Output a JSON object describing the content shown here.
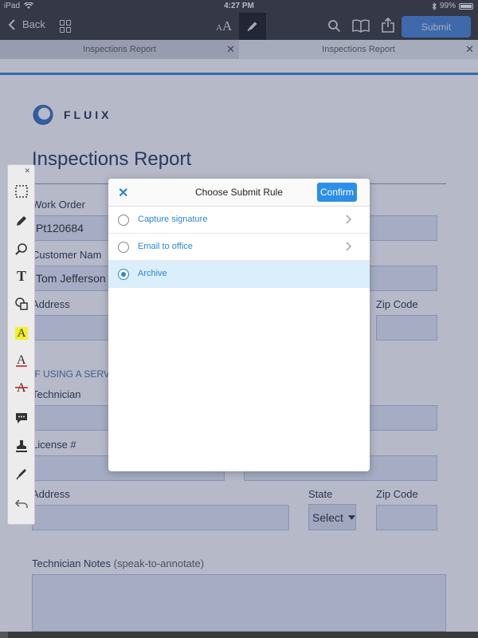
{
  "status_bar": {
    "device": "iPad",
    "time": "4:27 PM",
    "battery": "99%"
  },
  "toolbar": {
    "back_label": "Back",
    "submit_label": "Submit"
  },
  "tabs": [
    {
      "label": "Inspections Report"
    },
    {
      "label": "Inspections Report"
    }
  ],
  "document": {
    "logo_text": "FLUIX",
    "title": "Inspections Report",
    "work_order_label": "Work Order",
    "work_order_value": "Pt120684",
    "customer_name_label": "Customer Nam",
    "customer_name_value": "Tom Jefferson",
    "address_label": "Address",
    "zip_label": "Zip Code",
    "section_heading": "IF USING A SERV",
    "technician_label": "Technician",
    "license_label": "License #",
    "address2_label": "Address",
    "state_label": "State",
    "state_select_value": "Select",
    "zip2_label": "Zip Code",
    "notes_label": "Technician Notes",
    "notes_hint": "(speak-to-annotate)"
  },
  "modal": {
    "title": "Choose Submit Rule",
    "confirm_label": "Confirm",
    "options": [
      {
        "label": "Capture signature",
        "selected": false,
        "has_chevron": true
      },
      {
        "label": "Email to office",
        "selected": false,
        "has_chevron": true
      },
      {
        "label": "Archive",
        "selected": true,
        "has_chevron": false
      }
    ]
  },
  "icons": {
    "back": "chevron-left-icon",
    "grid": "grid-icon",
    "font": "font-size-icon",
    "pen": "pen-icon",
    "search": "search-icon",
    "book": "book-icon",
    "share": "share-icon"
  },
  "colors": {
    "accent": "#2a86d8",
    "submit_button": "#3f7fd0",
    "toolbar_bg": "#2f2f2f",
    "selected_row": "#dbeefb",
    "highlight_tool": "#f4f02b"
  }
}
